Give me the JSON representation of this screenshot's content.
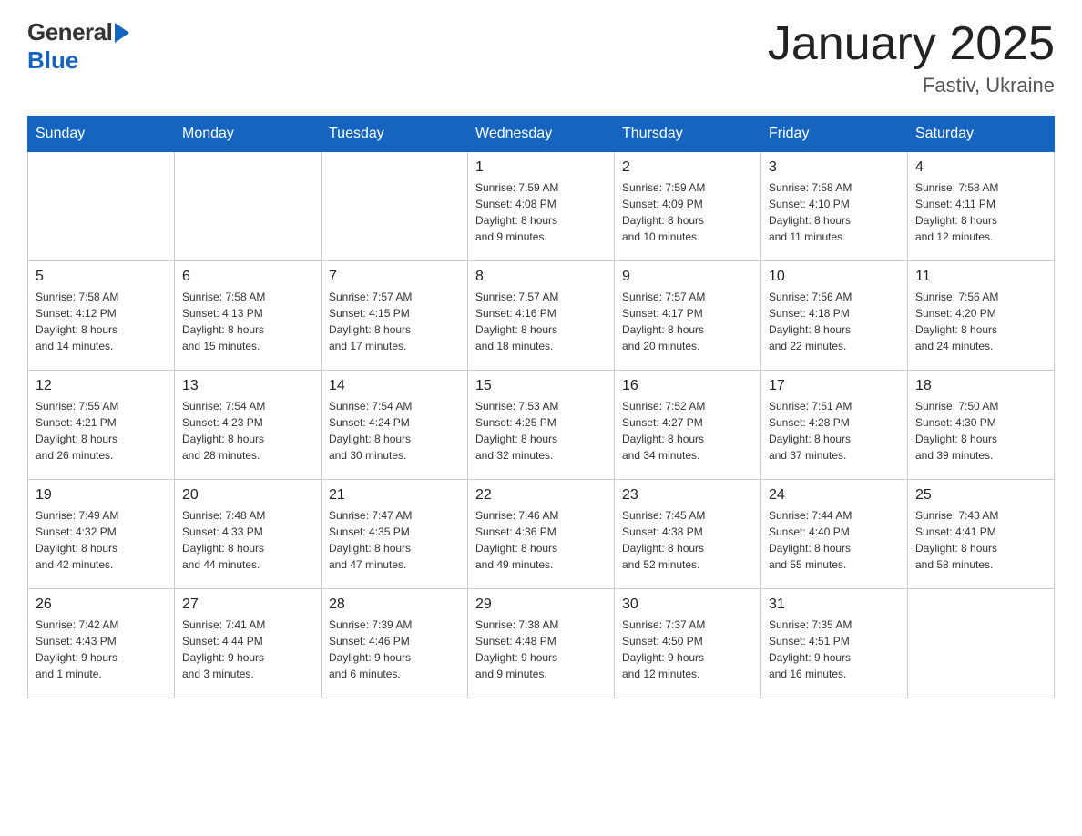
{
  "header": {
    "title": "January 2025",
    "subtitle": "Fastiv, Ukraine",
    "logo_general": "General",
    "logo_blue": "Blue"
  },
  "weekdays": [
    "Sunday",
    "Monday",
    "Tuesday",
    "Wednesday",
    "Thursday",
    "Friday",
    "Saturday"
  ],
  "weeks": [
    [
      {
        "day": "",
        "info": ""
      },
      {
        "day": "",
        "info": ""
      },
      {
        "day": "",
        "info": ""
      },
      {
        "day": "1",
        "info": "Sunrise: 7:59 AM\nSunset: 4:08 PM\nDaylight: 8 hours\nand 9 minutes."
      },
      {
        "day": "2",
        "info": "Sunrise: 7:59 AM\nSunset: 4:09 PM\nDaylight: 8 hours\nand 10 minutes."
      },
      {
        "day": "3",
        "info": "Sunrise: 7:58 AM\nSunset: 4:10 PM\nDaylight: 8 hours\nand 11 minutes."
      },
      {
        "day": "4",
        "info": "Sunrise: 7:58 AM\nSunset: 4:11 PM\nDaylight: 8 hours\nand 12 minutes."
      }
    ],
    [
      {
        "day": "5",
        "info": "Sunrise: 7:58 AM\nSunset: 4:12 PM\nDaylight: 8 hours\nand 14 minutes."
      },
      {
        "day": "6",
        "info": "Sunrise: 7:58 AM\nSunset: 4:13 PM\nDaylight: 8 hours\nand 15 minutes."
      },
      {
        "day": "7",
        "info": "Sunrise: 7:57 AM\nSunset: 4:15 PM\nDaylight: 8 hours\nand 17 minutes."
      },
      {
        "day": "8",
        "info": "Sunrise: 7:57 AM\nSunset: 4:16 PM\nDaylight: 8 hours\nand 18 minutes."
      },
      {
        "day": "9",
        "info": "Sunrise: 7:57 AM\nSunset: 4:17 PM\nDaylight: 8 hours\nand 20 minutes."
      },
      {
        "day": "10",
        "info": "Sunrise: 7:56 AM\nSunset: 4:18 PM\nDaylight: 8 hours\nand 22 minutes."
      },
      {
        "day": "11",
        "info": "Sunrise: 7:56 AM\nSunset: 4:20 PM\nDaylight: 8 hours\nand 24 minutes."
      }
    ],
    [
      {
        "day": "12",
        "info": "Sunrise: 7:55 AM\nSunset: 4:21 PM\nDaylight: 8 hours\nand 26 minutes."
      },
      {
        "day": "13",
        "info": "Sunrise: 7:54 AM\nSunset: 4:23 PM\nDaylight: 8 hours\nand 28 minutes."
      },
      {
        "day": "14",
        "info": "Sunrise: 7:54 AM\nSunset: 4:24 PM\nDaylight: 8 hours\nand 30 minutes."
      },
      {
        "day": "15",
        "info": "Sunrise: 7:53 AM\nSunset: 4:25 PM\nDaylight: 8 hours\nand 32 minutes."
      },
      {
        "day": "16",
        "info": "Sunrise: 7:52 AM\nSunset: 4:27 PM\nDaylight: 8 hours\nand 34 minutes."
      },
      {
        "day": "17",
        "info": "Sunrise: 7:51 AM\nSunset: 4:28 PM\nDaylight: 8 hours\nand 37 minutes."
      },
      {
        "day": "18",
        "info": "Sunrise: 7:50 AM\nSunset: 4:30 PM\nDaylight: 8 hours\nand 39 minutes."
      }
    ],
    [
      {
        "day": "19",
        "info": "Sunrise: 7:49 AM\nSunset: 4:32 PM\nDaylight: 8 hours\nand 42 minutes."
      },
      {
        "day": "20",
        "info": "Sunrise: 7:48 AM\nSunset: 4:33 PM\nDaylight: 8 hours\nand 44 minutes."
      },
      {
        "day": "21",
        "info": "Sunrise: 7:47 AM\nSunset: 4:35 PM\nDaylight: 8 hours\nand 47 minutes."
      },
      {
        "day": "22",
        "info": "Sunrise: 7:46 AM\nSunset: 4:36 PM\nDaylight: 8 hours\nand 49 minutes."
      },
      {
        "day": "23",
        "info": "Sunrise: 7:45 AM\nSunset: 4:38 PM\nDaylight: 8 hours\nand 52 minutes."
      },
      {
        "day": "24",
        "info": "Sunrise: 7:44 AM\nSunset: 4:40 PM\nDaylight: 8 hours\nand 55 minutes."
      },
      {
        "day": "25",
        "info": "Sunrise: 7:43 AM\nSunset: 4:41 PM\nDaylight: 8 hours\nand 58 minutes."
      }
    ],
    [
      {
        "day": "26",
        "info": "Sunrise: 7:42 AM\nSunset: 4:43 PM\nDaylight: 9 hours\nand 1 minute."
      },
      {
        "day": "27",
        "info": "Sunrise: 7:41 AM\nSunset: 4:44 PM\nDaylight: 9 hours\nand 3 minutes."
      },
      {
        "day": "28",
        "info": "Sunrise: 7:39 AM\nSunset: 4:46 PM\nDaylight: 9 hours\nand 6 minutes."
      },
      {
        "day": "29",
        "info": "Sunrise: 7:38 AM\nSunset: 4:48 PM\nDaylight: 9 hours\nand 9 minutes."
      },
      {
        "day": "30",
        "info": "Sunrise: 7:37 AM\nSunset: 4:50 PM\nDaylight: 9 hours\nand 12 minutes."
      },
      {
        "day": "31",
        "info": "Sunrise: 7:35 AM\nSunset: 4:51 PM\nDaylight: 9 hours\nand 16 minutes."
      },
      {
        "day": "",
        "info": ""
      }
    ]
  ]
}
